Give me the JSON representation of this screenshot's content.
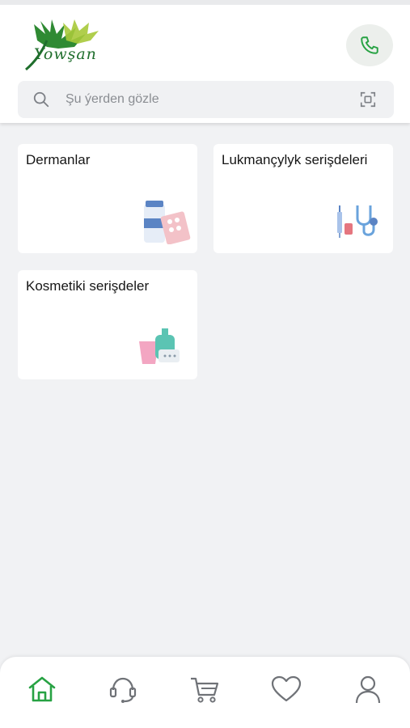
{
  "app": {
    "logo_text": "Yowşan",
    "accent_color": "#27a243"
  },
  "search": {
    "placeholder": "Şu ýerden gözle"
  },
  "categories": [
    {
      "label": "Dermanlar",
      "icon": "medicine-pills-icon"
    },
    {
      "label": "Lukmançylyk serişdeleri",
      "icon": "stethoscope-syringe-icon"
    },
    {
      "label": "Kosmetiki serişdeler",
      "icon": "cosmetics-icon"
    }
  ],
  "bottom_nav": {
    "items": [
      {
        "icon": "home-icon",
        "active": true
      },
      {
        "icon": "support-headset-icon",
        "active": false
      },
      {
        "icon": "cart-icon",
        "active": false
      },
      {
        "icon": "heart-icon",
        "active": false
      },
      {
        "icon": "profile-icon",
        "active": false
      }
    ]
  }
}
